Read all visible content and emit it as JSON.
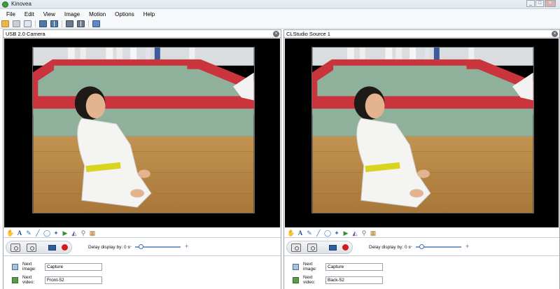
{
  "window": {
    "title": "Kinovea",
    "minimize_label": "_",
    "maximize_label": "□",
    "close_label": "×"
  },
  "menu": [
    {
      "label": "File"
    },
    {
      "label": "Edit"
    },
    {
      "label": "View"
    },
    {
      "label": "Image"
    },
    {
      "label": "Motion"
    },
    {
      "label": "Options"
    },
    {
      "label": "Help"
    }
  ],
  "toolbar": {
    "icons": [
      "open-folder-icon",
      "save-icon",
      "screen-icon",
      "single-screen-icon",
      "dual-screen-icon",
      "capture-screen-icon",
      "dual-capture-icon",
      "swap-screens-icon"
    ]
  },
  "panes": [
    {
      "title": "USB 2.0 Camera",
      "close_label": "×",
      "delay_label": "Delay display by: 0 s",
      "next_image_label": "Next image:",
      "next_image_value": "Capture",
      "next_video_label": "Next video:",
      "next_video_value": "Front-52",
      "slider_minus": "−",
      "slider_plus": "+"
    },
    {
      "title": "CLStudio Source 1",
      "close_label": "×",
      "delay_label": "Delay display by: 0 s",
      "next_image_label": "Next image:",
      "next_image_value": "Capture",
      "next_video_label": "Next video:",
      "next_video_value": "Back-52",
      "slider_minus": "−",
      "slider_plus": "+"
    }
  ],
  "drawing_tools": {
    "text_tool_glyph": "A",
    "icons": [
      "hand-icon",
      "text-icon",
      "pencil-icon",
      "line-icon",
      "circle-icon",
      "cross-marker-icon",
      "angle-icon",
      "chronometer-icon",
      "magnifier-icon",
      "grid-icon"
    ]
  },
  "colors": {
    "record": "#d21a1a",
    "accent_blue": "#3f6fae",
    "mat_green": "#8fb09b",
    "mat_red": "#c9343d",
    "floor_wood": "#b88a4a"
  }
}
